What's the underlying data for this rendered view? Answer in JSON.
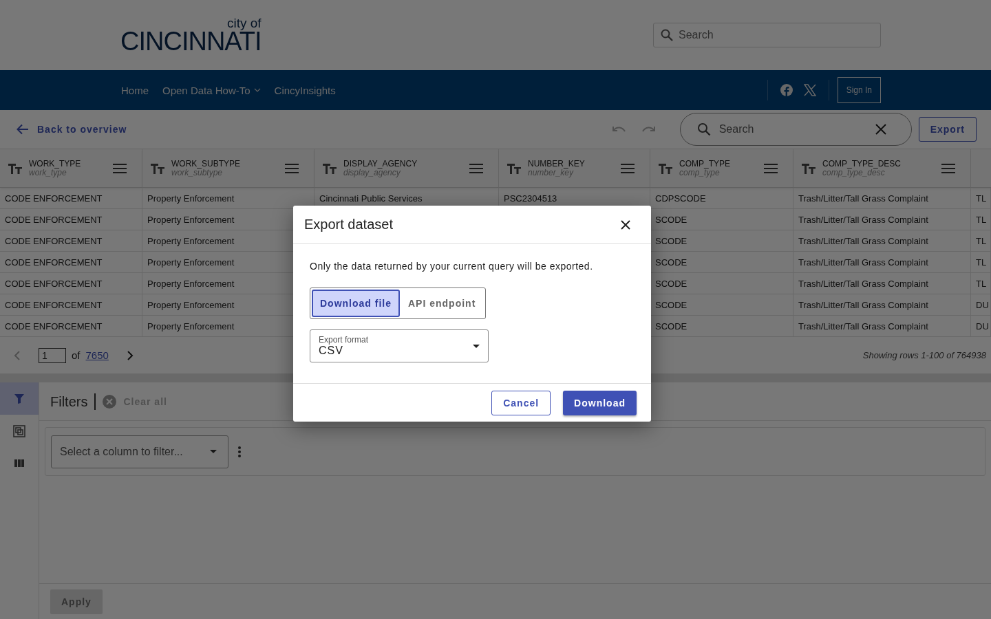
{
  "header": {
    "logo": {
      "small": "city of",
      "big": "CINCINNATI"
    },
    "search": {
      "placeholder": "Search"
    }
  },
  "nav": {
    "items": [
      {
        "label": "Home",
        "has_menu": false
      },
      {
        "label": "Open Data How-To",
        "has_menu": true
      },
      {
        "label": "CincyInsights",
        "has_menu": false
      }
    ],
    "sign_in": "Sign In"
  },
  "toolbar": {
    "back": "Back to overview",
    "search": {
      "placeholder": "Search"
    },
    "export": "Export"
  },
  "table": {
    "columns": [
      {
        "kind": "full",
        "title": "WORK_TYPE",
        "subtitle": "work_type"
      },
      {
        "kind": "full",
        "title": "WORK_SUBTYPE",
        "subtitle": "work_subtype"
      },
      {
        "kind": "full",
        "title": "DISPLAY_AGENCY",
        "subtitle": "display_agency"
      },
      {
        "kind": "full",
        "title": "NUMBER_KEY",
        "subtitle": "number_key"
      },
      {
        "kind": "full",
        "title": "COMP_TYPE",
        "subtitle": "comp_type"
      },
      {
        "kind": "full",
        "title": "COMP_TYPE_DESC",
        "subtitle": "comp_type_desc"
      },
      {
        "kind": "clipped"
      }
    ],
    "rows": [
      [
        "CODE ENFORCEMENT",
        "Property Enforcement",
        "Cincinnati Public Services",
        "PSC2304513",
        "CDPSCODE",
        "Trash/Litter/Tall Grass Complaint",
        "TL"
      ],
      [
        "CODE ENFORCEMENT",
        "Property Enforcement",
        null,
        null,
        "SCODE",
        "Trash/Litter/Tall Grass Complaint",
        "TL"
      ],
      [
        "CODE ENFORCEMENT",
        "Property Enforcement",
        null,
        null,
        "SCODE",
        "Trash/Litter/Tall Grass Complaint",
        "TL"
      ],
      [
        "CODE ENFORCEMENT",
        "Property Enforcement",
        null,
        null,
        "SCODE",
        "Trash/Litter/Tall Grass Complaint",
        "TL"
      ],
      [
        "CODE ENFORCEMENT",
        "Property Enforcement",
        null,
        null,
        "SCODE",
        "Trash/Litter/Tall Grass Complaint",
        "TL"
      ],
      [
        "CODE ENFORCEMENT",
        "Property Enforcement",
        null,
        null,
        "SCODE",
        "Trash/Litter/Tall Grass Complaint",
        "DU"
      ],
      [
        "CODE ENFORCEMENT",
        "Property Enforcement",
        null,
        null,
        "SCODE",
        "Trash/Litter/Tall Grass Complaint",
        "DU"
      ]
    ]
  },
  "pagination": {
    "page": "1",
    "of_label": "of",
    "total": "7650",
    "status": "Showing rows 1-100 of 764938"
  },
  "filters": {
    "rail": [
      {
        "kind": "filter",
        "selected": true
      },
      {
        "kind": "group",
        "selected": false
      },
      {
        "kind": "columns",
        "selected": false
      }
    ],
    "title": "Filters",
    "clear": "Clear all",
    "select": {
      "placeholder": "Select a column to filter..."
    },
    "apply": {
      "label": "Apply",
      "disabled": true
    }
  },
  "dialog": {
    "title": "Export dataset",
    "text": "Only the data returned by your current query will be exported.",
    "tabs": [
      {
        "label": "Download file",
        "selected": true
      },
      {
        "label": "API endpoint",
        "selected": false
      }
    ],
    "format": {
      "label": "Export format",
      "value": "CSV"
    },
    "buttons": {
      "cancel": "Cancel",
      "download": "Download"
    }
  }
}
